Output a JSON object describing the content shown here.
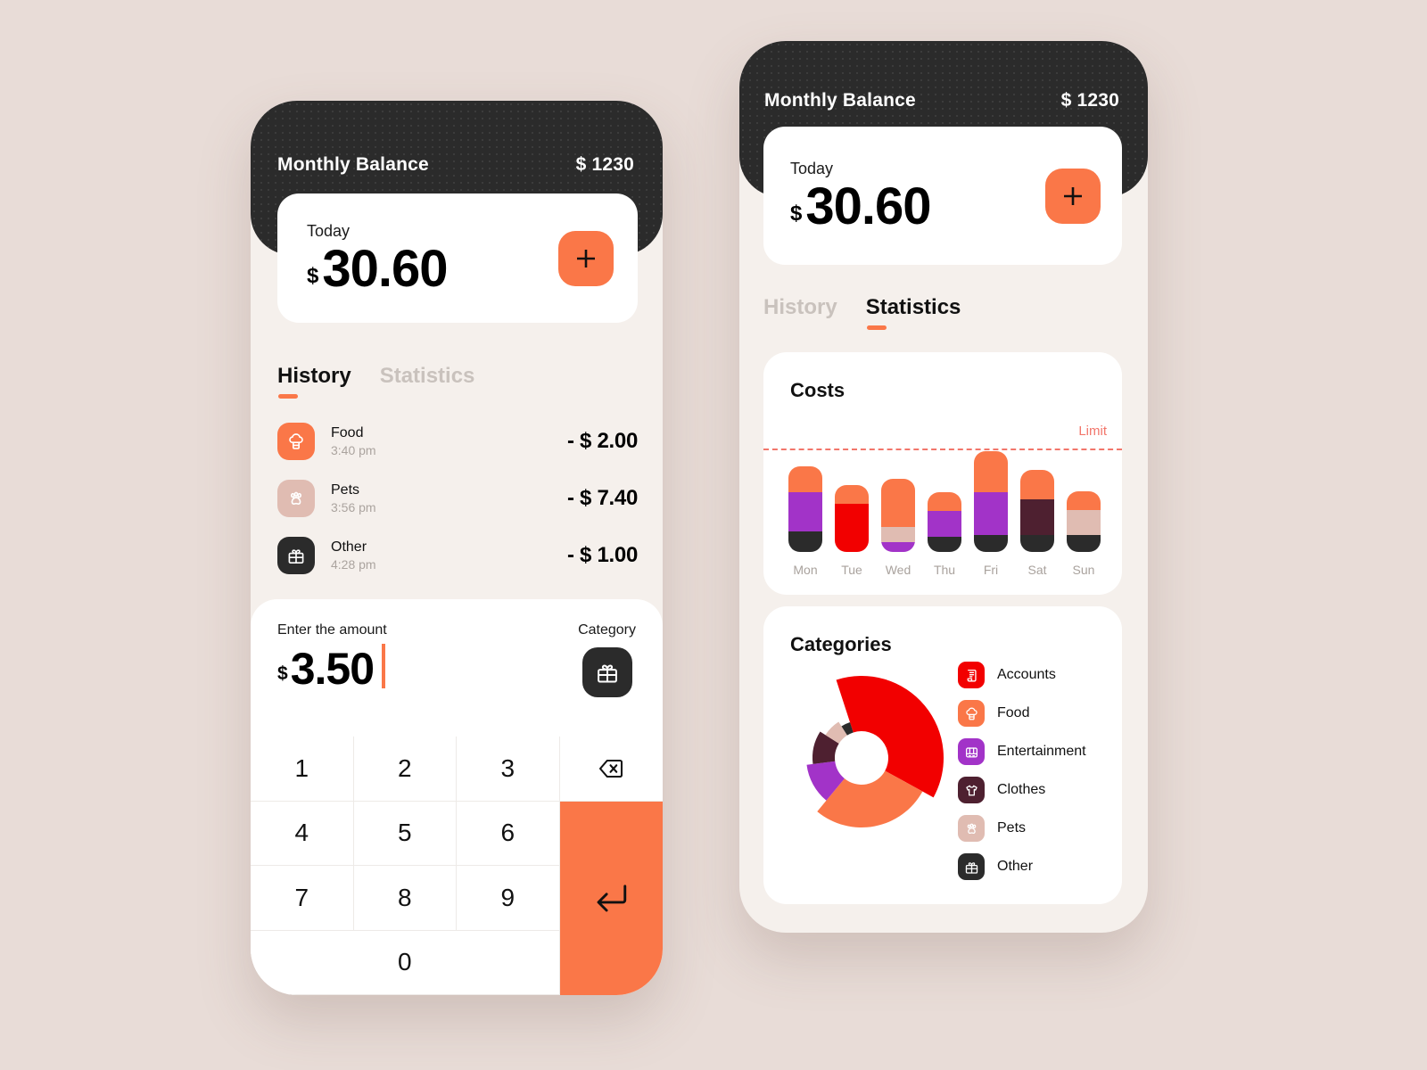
{
  "app": {
    "background_color": "#E8DCD7",
    "accent_color": "#FA7748",
    "dark_color": "#2B2B2B"
  },
  "header": {
    "title": "Monthly Balance",
    "balance": "$ 1230"
  },
  "today_card": {
    "label": "Today",
    "currency": "$",
    "value": "30.60",
    "add_button_icon": "plus-icon"
  },
  "tabs": {
    "history": "History",
    "statistics": "Statistics",
    "left_active": "History",
    "right_active": "Statistics"
  },
  "history": {
    "items": [
      {
        "category": "Food",
        "time": "3:40 pm",
        "amount": "- $ 2.00",
        "icon": "chef-hat-icon",
        "icon_bg": "#FA7748",
        "icon_fg": "#FFFFFF"
      },
      {
        "category": "Pets",
        "time": "3:56 pm",
        "amount": "- $ 7.40",
        "icon": "paw-icon",
        "icon_bg": "#E0BCB2",
        "icon_fg": "#FFFFFF"
      },
      {
        "category": "Other",
        "time": "4:28 pm",
        "amount": "- $ 1.00",
        "icon": "gift-icon",
        "icon_bg": "#2B2B2B",
        "icon_fg": "#FFFFFF"
      }
    ]
  },
  "entry": {
    "amount_label": "Enter the amount",
    "category_label": "Category",
    "currency": "$",
    "value": "3.50",
    "category_icon": "gift-icon",
    "keys": [
      "1",
      "2",
      "3",
      "4",
      "5",
      "6",
      "7",
      "8",
      "9",
      "0"
    ],
    "backspace_icon": "backspace-icon",
    "enter_icon": "enter-arrow-icon"
  },
  "costs_card": {
    "title": "Costs",
    "limit_label": "Limit"
  },
  "categories_card": {
    "title": "Categories",
    "legend": [
      {
        "label": "Accounts",
        "color": "#F20000",
        "icon": "scroll-icon"
      },
      {
        "label": "Food",
        "color": "#FA7748",
        "icon": "chef-hat-icon"
      },
      {
        "label": "Entertainment",
        "color": "#A233C8",
        "icon": "projector-icon"
      },
      {
        "label": "Clothes",
        "color": "#4E2030",
        "icon": "tshirt-icon"
      },
      {
        "label": "Pets",
        "color": "#E0BCB2",
        "icon": "paw-icon"
      },
      {
        "label": "Other",
        "color": "#2B2B2B",
        "icon": "gift-icon"
      }
    ]
  },
  "chart_data": [
    {
      "type": "bar",
      "title": "Costs",
      "subtitle": "",
      "stacked": true,
      "xlabel": "",
      "ylabel": "",
      "categories": [
        "Mon",
        "Tue",
        "Wed",
        "Thu",
        "Fri",
        "Sat",
        "Sun"
      ],
      "ylim": [
        0,
        100
      ],
      "grid": false,
      "legend_position": "none",
      "annotations": [
        {
          "text": "Limit",
          "type": "threshold-line",
          "value": 88,
          "color": "#F2766B",
          "style": "dashed"
        }
      ],
      "series": [
        {
          "name": "Food",
          "color": "#FA7748",
          "values": [
            22,
            16,
            40,
            16,
            34,
            25,
            16
          ]
        },
        {
          "name": "Entertainment",
          "color": "#A233C8",
          "values": [
            33,
            0,
            8,
            21,
            36,
            0,
            0
          ]
        },
        {
          "name": "Other",
          "color": "#2B2B2B",
          "values": [
            17,
            0,
            0,
            13,
            14,
            14,
            14
          ]
        },
        {
          "name": "Accounts",
          "color": "#F20000",
          "values": [
            0,
            40,
            0,
            0,
            0,
            0,
            0
          ]
        },
        {
          "name": "Pets",
          "color": "#E0BCB2",
          "values": [
            0,
            0,
            13,
            0,
            0,
            0,
            21
          ]
        },
        {
          "name": "Clothes",
          "color": "#4E2030",
          "values": [
            0,
            0,
            0,
            0,
            0,
            30,
            0
          ]
        }
      ],
      "totals": [
        72,
        56,
        61,
        50,
        84,
        69,
        51
      ]
    },
    {
      "type": "pie",
      "title": "Categories",
      "donut": true,
      "legend_position": "right",
      "labels": [
        "Accounts",
        "Food",
        "Entertainment",
        "Clothes",
        "Pets",
        "Other"
      ],
      "colors": [
        "#F20000",
        "#FA7748",
        "#A233C8",
        "#4E2030",
        "#E0BCB2",
        "#2B2B2B"
      ],
      "values": [
        38,
        28,
        12,
        11,
        7,
        4
      ],
      "radii": [
        92,
        78,
        62,
        55,
        48,
        42
      ]
    }
  ]
}
